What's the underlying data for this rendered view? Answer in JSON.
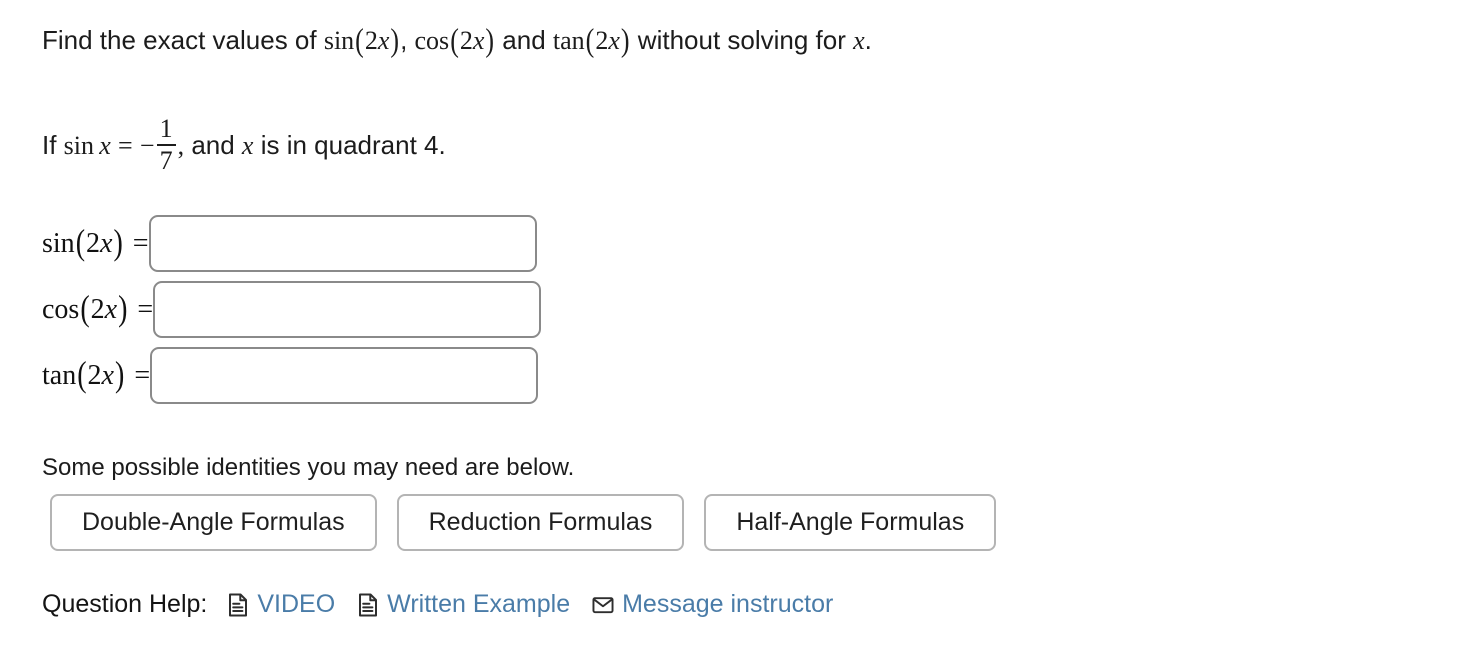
{
  "question": {
    "prompt": {
      "lead": "Find the exact values of ",
      "fn1": "sin",
      "fn2": "cos",
      "mid": " and ",
      "fn3": "tan",
      "arg": "2",
      "variable": "x",
      "tail": " without solving for ",
      "end": "."
    },
    "given": {
      "lead": "If ",
      "fn": "sin",
      "variable": "x",
      "equals": "=",
      "minus": "−",
      "numerator": "1",
      "denominator": "7",
      "comma": ",",
      "mid": " and ",
      "variable2": "x",
      "tail": " is in quadrant 4."
    }
  },
  "answers": {
    "rows": [
      {
        "fn": "sin",
        "arg": "2",
        "variable": "x",
        "equals": "=",
        "value": "",
        "placeholder": ""
      },
      {
        "fn": "cos",
        "arg": "2",
        "variable": "x",
        "equals": "=",
        "value": "",
        "placeholder": ""
      },
      {
        "fn": "tan",
        "arg": "2",
        "variable": "x",
        "equals": "=",
        "value": "",
        "placeholder": ""
      }
    ]
  },
  "identities": {
    "heading": "Some possible identities you may need are below.",
    "buttons": [
      {
        "label": "Double-Angle Formulas"
      },
      {
        "label": "Reduction Formulas"
      },
      {
        "label": "Half-Angle Formulas"
      }
    ]
  },
  "question_help": {
    "label": "Question Help:",
    "links": [
      {
        "icon": "document-icon",
        "label": "VIDEO"
      },
      {
        "icon": "document-icon",
        "label": "Written Example"
      },
      {
        "icon": "envelope-icon",
        "label": "Message instructor"
      }
    ],
    "link_color": "#4a7ca8"
  },
  "colors": {
    "background": "#ffffff",
    "text": "#1c1c1c",
    "input_border": "#8a8a8a",
    "button_border": "#b4b4b4",
    "link": "#4a7ca8",
    "icon": "#2e2e2e"
  }
}
